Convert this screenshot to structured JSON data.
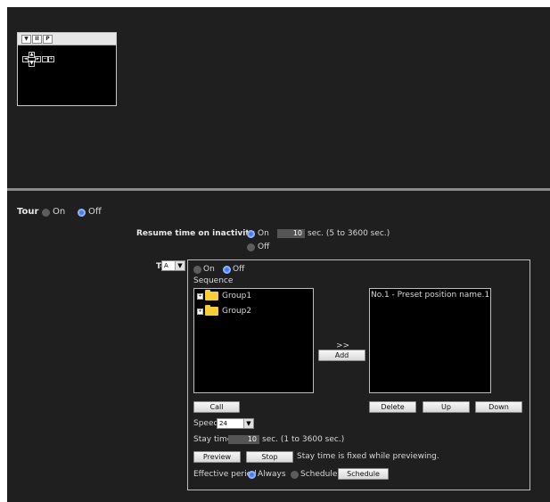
{
  "viewer": {
    "toolbar": [
      "▼",
      "II",
      "P"
    ],
    "ptz_glyphs": [
      "◄",
      "▲",
      "▼",
      "►",
      "−",
      "+"
    ]
  },
  "tour": {
    "label": "Tour",
    "on_label": "On",
    "off_label": "Off",
    "selected": "Off"
  },
  "resume": {
    "label": "Resume time on inactivity",
    "on_label": "On",
    "off_label": "Off",
    "selected": "On",
    "value": "10",
    "unit_hint": "sec. (5 to 3600 sec.)"
  },
  "tour_select": {
    "label": "Tour",
    "value": "A"
  },
  "panel": {
    "on_label": "On",
    "off_label": "Off",
    "selected": "Off",
    "sequence_label": "Sequence",
    "groups": [
      "Group1",
      "Group2"
    ],
    "add_arrow": ">>",
    "add_label": "Add",
    "sequence_items": [
      "No.1 - Preset position name.1"
    ],
    "call_label": "Call",
    "delete_label": "Delete",
    "up_label": "Up",
    "down_label": "Down",
    "speed_label": "Speed",
    "speed_value": "24",
    "stay_label": "Stay time",
    "stay_value": "10",
    "stay_hint": "sec. (1 to 3600 sec.)",
    "preview_label": "Preview",
    "stop_label": "Stop",
    "preview_note": "Stay time is fixed while previewing.",
    "effective_label": "Effective period",
    "always_label": "Always",
    "schedule_label": "Schedule",
    "schedule_button": "Schedule",
    "effective_selected": "Always"
  },
  "colors": {
    "background": "#1f1f1f",
    "radio_selected": "#4d7fe8",
    "radio_unselected": "#5d5d5d",
    "folder": "#f4cf38"
  }
}
